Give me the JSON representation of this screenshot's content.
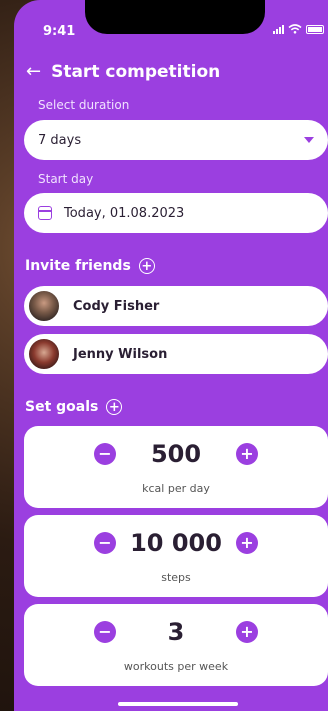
{
  "status": {
    "time": "9:41"
  },
  "header": {
    "title": "Start competition"
  },
  "duration": {
    "label": "Select duration",
    "value": "7 days"
  },
  "start_day": {
    "label": "Start day",
    "value": "Today, 01.08.2023"
  },
  "invite": {
    "label": "Invite friends",
    "friends": [
      {
        "name": "Cody Fisher"
      },
      {
        "name": "Jenny Wilson"
      }
    ]
  },
  "goals": {
    "label": "Set goals",
    "items": [
      {
        "value": "500",
        "unit": "kcal per day"
      },
      {
        "value": "10 000",
        "unit": "steps"
      },
      {
        "value": "3",
        "unit": "workouts per week"
      }
    ]
  },
  "icons": {
    "back": "arrow-left-icon",
    "dropdown": "caret-down-icon",
    "calendar": "calendar-icon",
    "add": "plus-circle-icon",
    "minus": "minus-icon",
    "plus": "plus-icon"
  },
  "colors": {
    "accent": "#9b3fe0",
    "card": "#ffffff"
  }
}
